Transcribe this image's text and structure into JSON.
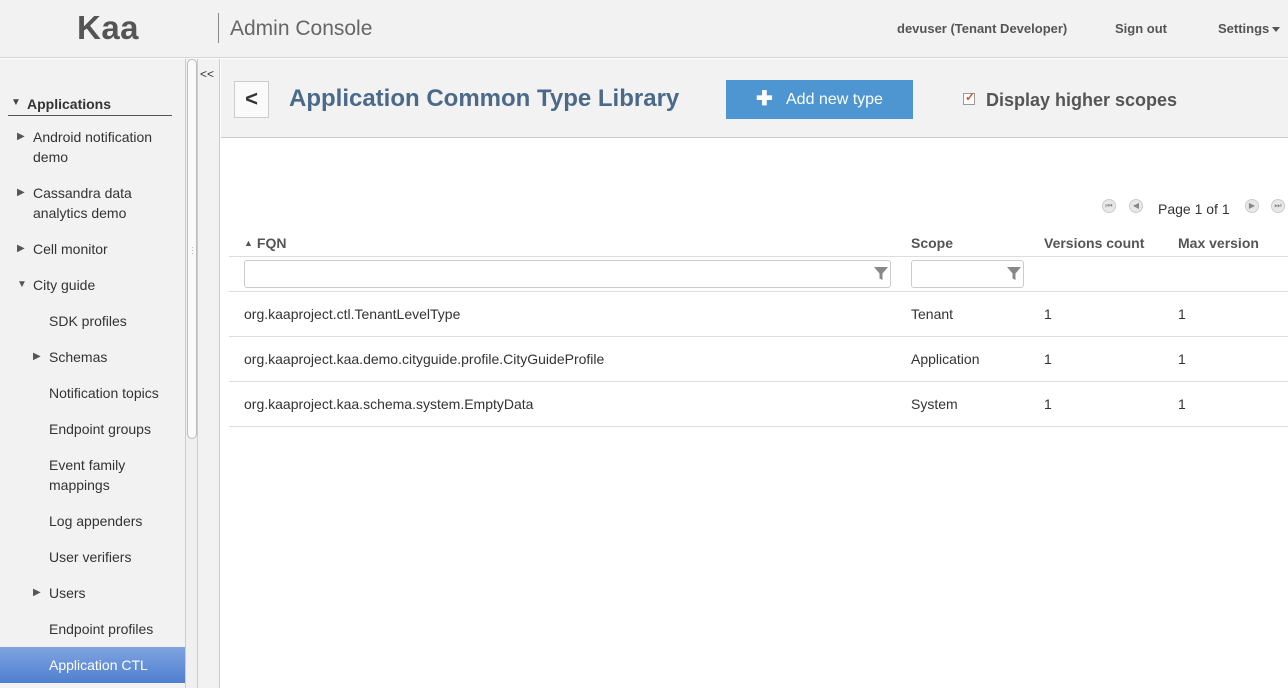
{
  "header": {
    "logo": "Kaa",
    "app_title": "Admin Console",
    "user": "devuser (Tenant Developer)",
    "sign_out": "Sign out",
    "settings": "Settings"
  },
  "sidebar": {
    "root": "Applications",
    "items": [
      {
        "label1": "Android notification",
        "label2": "demo"
      },
      {
        "label1": "Cassandra data",
        "label2": "analytics demo"
      },
      {
        "label1": "Cell monitor"
      },
      {
        "label1": "City guide"
      },
      {
        "label1": "SDK profiles"
      },
      {
        "label1": "Schemas"
      },
      {
        "label1": "Notification topics"
      },
      {
        "label1": "Endpoint groups"
      },
      {
        "label1": "Event family",
        "label2": "mappings"
      },
      {
        "label1": "Log appenders"
      },
      {
        "label1": "User verifiers"
      },
      {
        "label1": "Users"
      },
      {
        "label1": "Endpoint profiles"
      },
      {
        "label1": "Application CTL"
      }
    ],
    "collapse_label": "<<"
  },
  "toolbar": {
    "back": "<",
    "title": "Application Common Type Library",
    "add_button": "Add new type",
    "display_higher": "Display higher scopes",
    "display_higher_checked": true
  },
  "pager": {
    "text": "Page 1 of 1"
  },
  "table": {
    "columns": [
      "FQN",
      "Scope",
      "Versions count",
      "Max version"
    ],
    "rows": [
      [
        "org.kaaproject.ctl.TenantLevelType",
        "Tenant",
        "1",
        "1"
      ],
      [
        "org.kaaproject.kaa.demo.cityguide.profile.CityGuideProfile",
        "Application",
        "1",
        "1"
      ],
      [
        "org.kaaproject.kaa.schema.system.EmptyData",
        "System",
        "1",
        "1"
      ]
    ]
  },
  "colors": {
    "accent": "#4e96d2",
    "title": "#4b6a8a",
    "selected_nav": "#5b88d4"
  }
}
